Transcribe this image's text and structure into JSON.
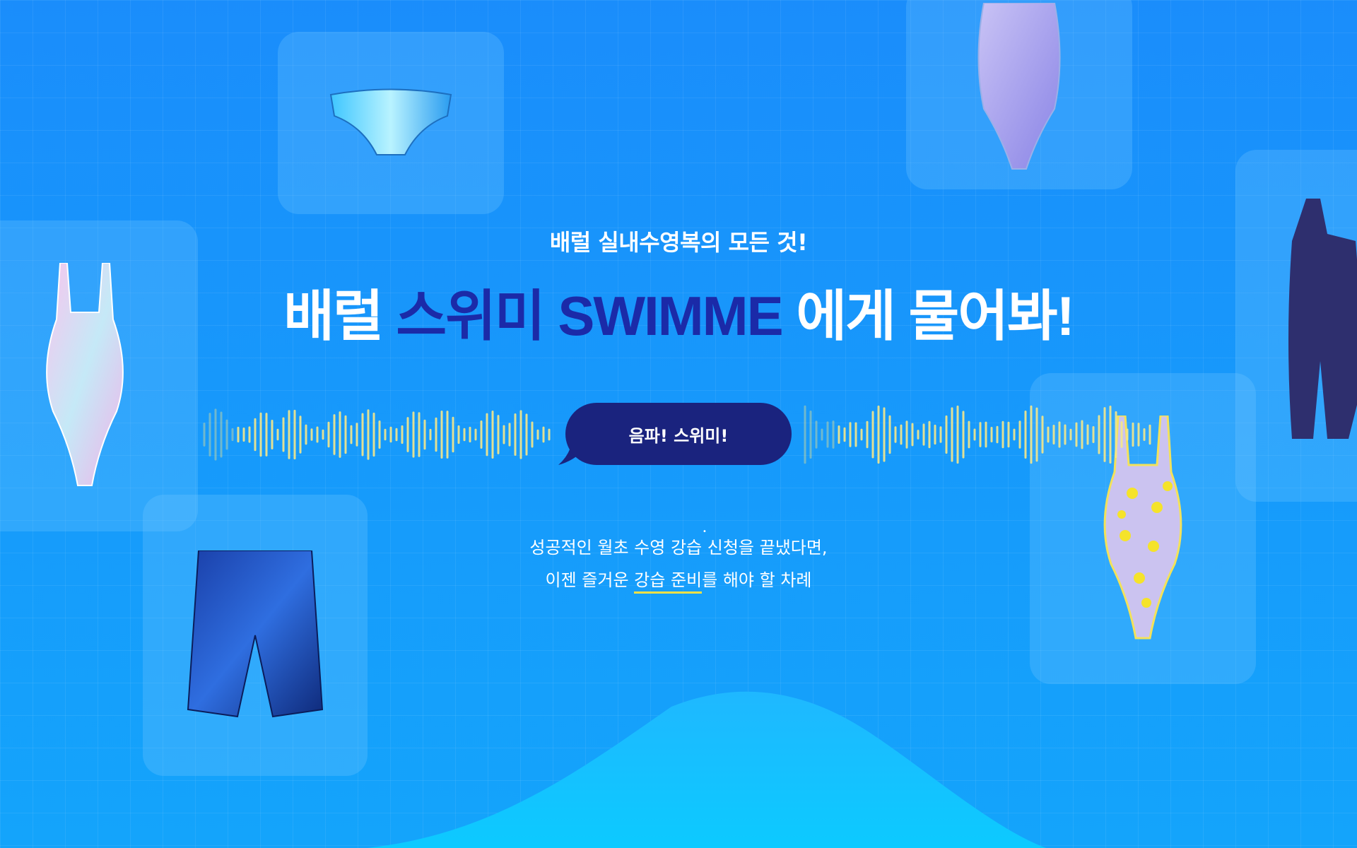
{
  "banner": {
    "subtitle": "배럴 실내수영복의 모든 것!",
    "title_part1": "배럴 ",
    "title_accent": "스위미 SWIMME",
    "title_part2": " 에게 물어봐!",
    "bubble_label": "음파! 스위미!",
    "desc_line1_a": "성공적인 월초 수영 ",
    "desc_line1_dots": "강습 신청",
    "desc_line1_b": "을 끝냈다면,",
    "desc_line2_a": "이젠 즐거운 ",
    "desc_line2_underline": "강습 준비",
    "desc_line2_b": "를 해야 할 차례"
  },
  "colors": {
    "background": "#1a8dfb",
    "accent_title": "#1b2aa8",
    "bubble": "#1a237e",
    "bars": "#f6e88a",
    "underline": "#f6e046"
  },
  "products": [
    {
      "name": "swim-briefs",
      "pattern": "iridescent-blue"
    },
    {
      "name": "swimsuit-lavender",
      "pattern": "purple-leaf"
    },
    {
      "name": "swimsuit-pink",
      "pattern": "holographic-pink"
    },
    {
      "name": "jammer-navy",
      "pattern": "blue-marble"
    },
    {
      "name": "swimsuit-yellow-floral",
      "pattern": "yellow-flower"
    },
    {
      "name": "unitard-navy",
      "pattern": "solid-navy"
    }
  ]
}
